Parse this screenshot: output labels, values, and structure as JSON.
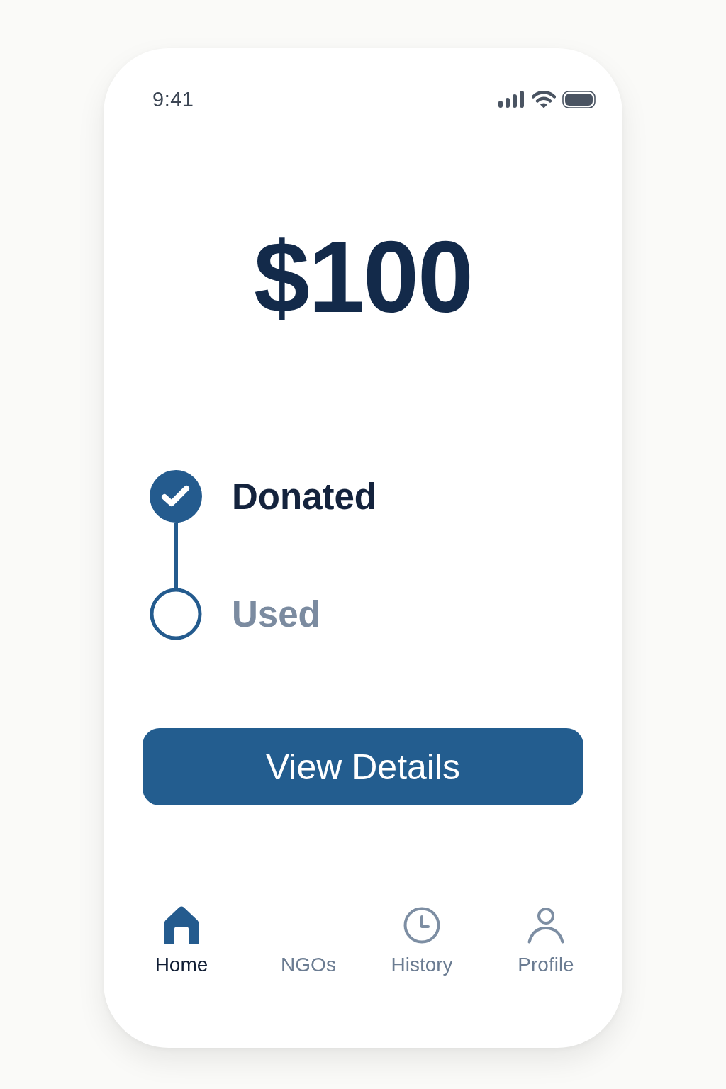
{
  "status_bar": {
    "time": "9:41"
  },
  "amount": "$100",
  "steps": [
    {
      "label": "Donated",
      "completed": true
    },
    {
      "label": "Used",
      "completed": false
    }
  ],
  "primary_button": {
    "label": "View Details"
  },
  "nav": [
    {
      "label": "Home",
      "selected": true
    },
    {
      "label": "NGOs",
      "selected": false
    },
    {
      "label": "History",
      "selected": false
    },
    {
      "label": "Profile",
      "selected": false
    }
  ]
}
